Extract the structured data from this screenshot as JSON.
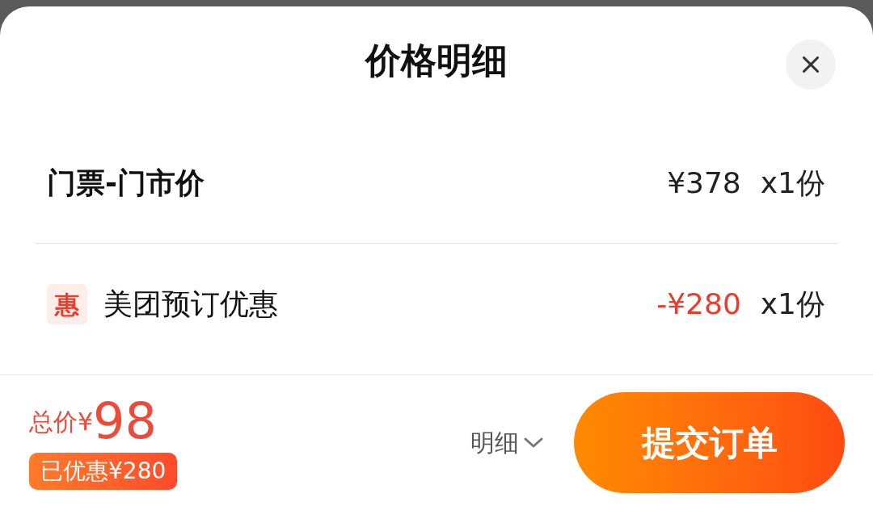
{
  "sheet": {
    "title": "价格明细"
  },
  "items": [
    {
      "kind": "plain",
      "name": "门票-门市价",
      "price": "¥378",
      "quantity": "x1份"
    },
    {
      "kind": "discount",
      "badge": "惠",
      "name": "美团预订优惠",
      "price": "-¥280",
      "quantity": "x1份"
    }
  ],
  "footer": {
    "total_label": "总价¥",
    "total": "98",
    "saved": "已优惠¥280",
    "details": "明细",
    "submit": "提交订单"
  }
}
